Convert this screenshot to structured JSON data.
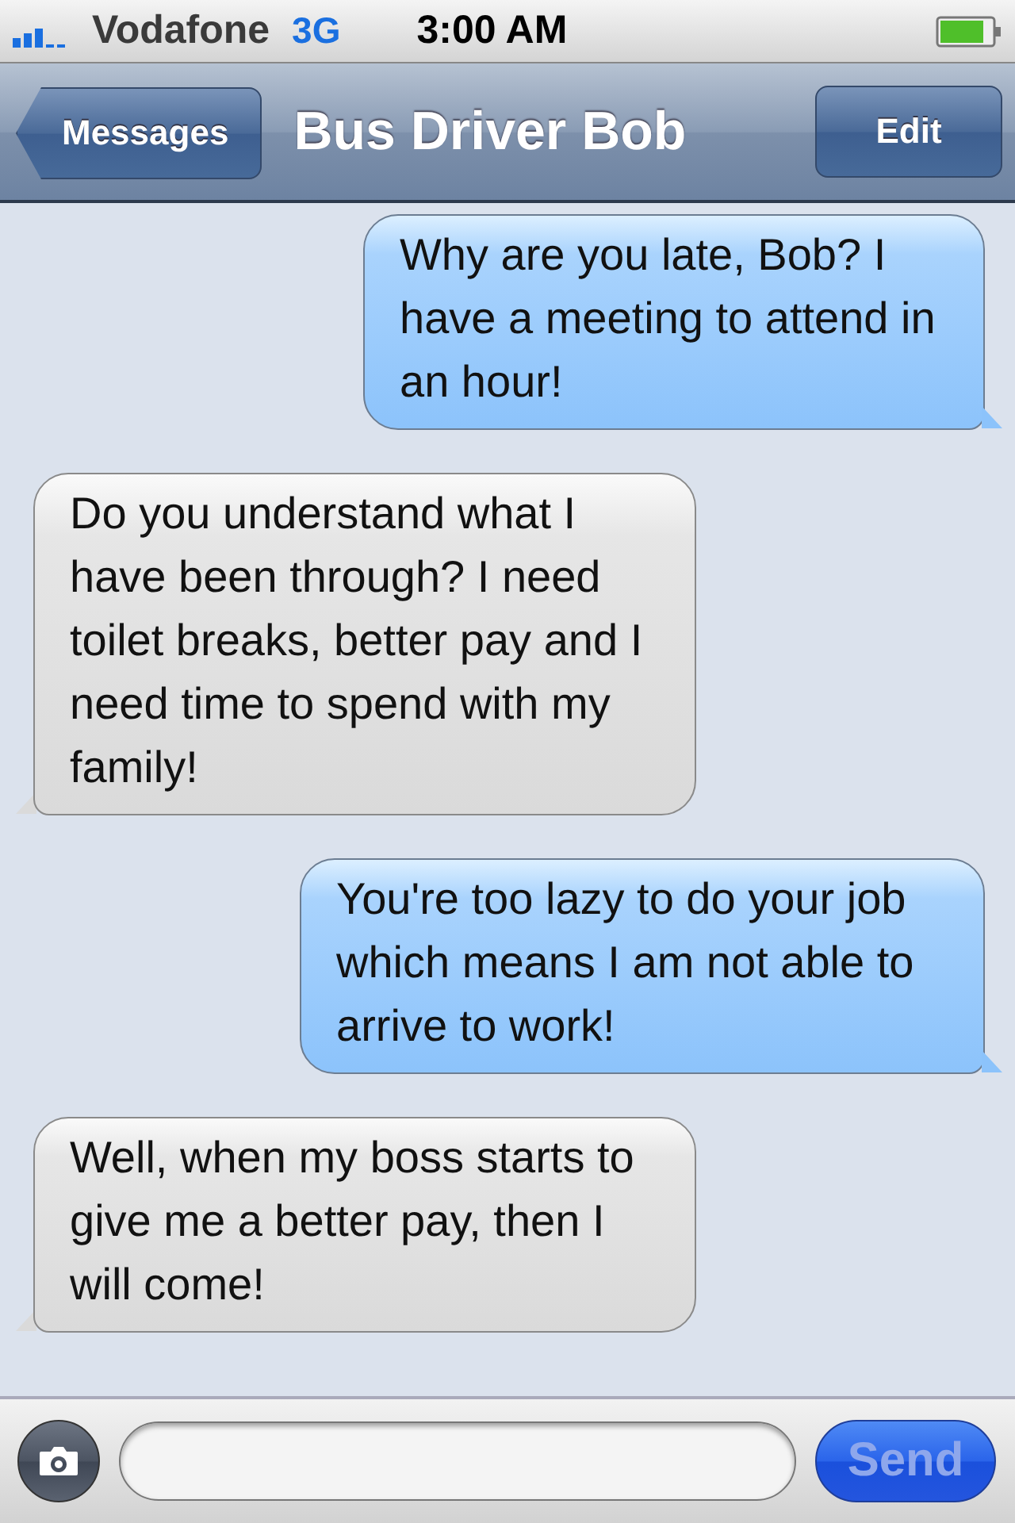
{
  "status_bar": {
    "carrier": "Vodafone",
    "network": "3G",
    "time": "3:00 AM"
  },
  "nav_bar": {
    "back_button": "Messages",
    "title": "Bus Driver Bob",
    "edit_button": "Edit"
  },
  "messages": [
    {
      "kind": "sent",
      "text": "Why are you late, Bob? I have a meeting to attend in an hour!"
    },
    {
      "kind": "received",
      "text": "Do you understand what I have been through? I need toilet breaks, better pay and I need time to spend with my family!"
    },
    {
      "kind": "sent",
      "text": "You're too lazy to do your job which means I am not able to arrive to work!"
    },
    {
      "kind": "received",
      "text": "Well, when my boss starts to give me a better pay, then I will come!"
    }
  ],
  "compose_bar": {
    "send_button": {
      "label": "Send",
      "disabled": true
    }
  }
}
